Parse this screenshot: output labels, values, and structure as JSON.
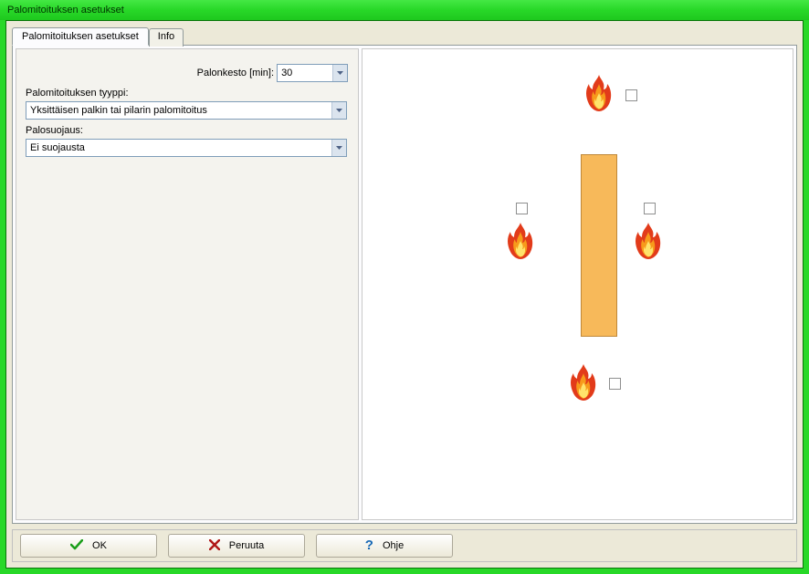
{
  "window": {
    "title": "Palomitoituksen asetukset"
  },
  "tabs": {
    "main": "Palomitoituksen asetukset",
    "info": "Info"
  },
  "form": {
    "duration_label": "Palonkesto [min]:",
    "duration_value": "30",
    "type_label": "Palomitoituksen tyyppi:",
    "type_value": "Yksittäisen palkin tai pilarin palomitoitus",
    "protection_label": "Palosuojaus:",
    "protection_value": "Ei suojausta"
  },
  "diagram": {
    "fire_top": {
      "checked": false
    },
    "fire_left": {
      "checked": false
    },
    "fire_right": {
      "checked": false
    },
    "fire_bottom": {
      "checked": false
    }
  },
  "buttons": {
    "ok": "OK",
    "cancel": "Peruuta",
    "help": "Ohje"
  }
}
